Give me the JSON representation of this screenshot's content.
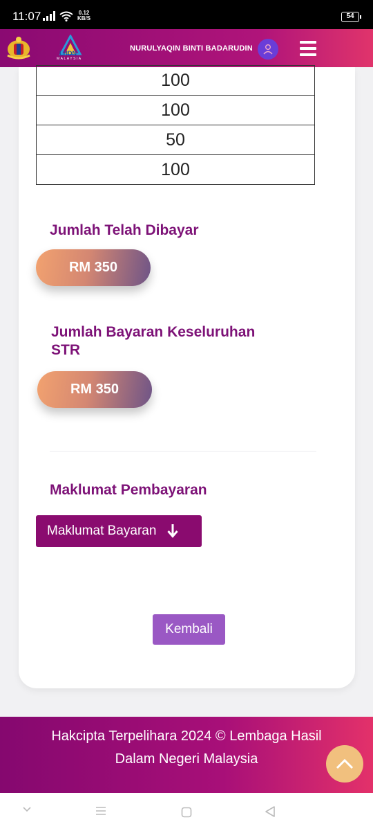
{
  "status_bar": {
    "time": "11:07",
    "speed_value": "0.12",
    "speed_unit": "KB/S",
    "battery": "54"
  },
  "header": {
    "logo_text": "LHDN",
    "logo_subtext": "MALAYSIA",
    "username": "NURULYAQIN BINTI BADARUDIN"
  },
  "payments_table": {
    "rows": [
      "100",
      "100",
      "50",
      "100"
    ]
  },
  "paid_section": {
    "label": "Jumlah Telah Dibayar",
    "amount": "RM 350"
  },
  "total_section": {
    "label_line1": "Jumlah Bayaran Keseluruhan",
    "label_line2": "STR",
    "amount": "RM 350"
  },
  "payment_info": {
    "label": "Maklumat Pembayaran",
    "button_label": "Maklumat Bayaran"
  },
  "actions": {
    "back_label": "Kembali"
  },
  "footer": {
    "line1": "Hakcipta Terpelihara 2024 © Lembaga Hasil",
    "line2": "Dalam Negeri Malaysia"
  },
  "colors": {
    "brand_primary": "#8a0b6f",
    "brand_accent": "#e0346b",
    "label_text": "#7d1277",
    "back_button": "#9a58c4",
    "scroll_top_button": "#f1c07e"
  }
}
